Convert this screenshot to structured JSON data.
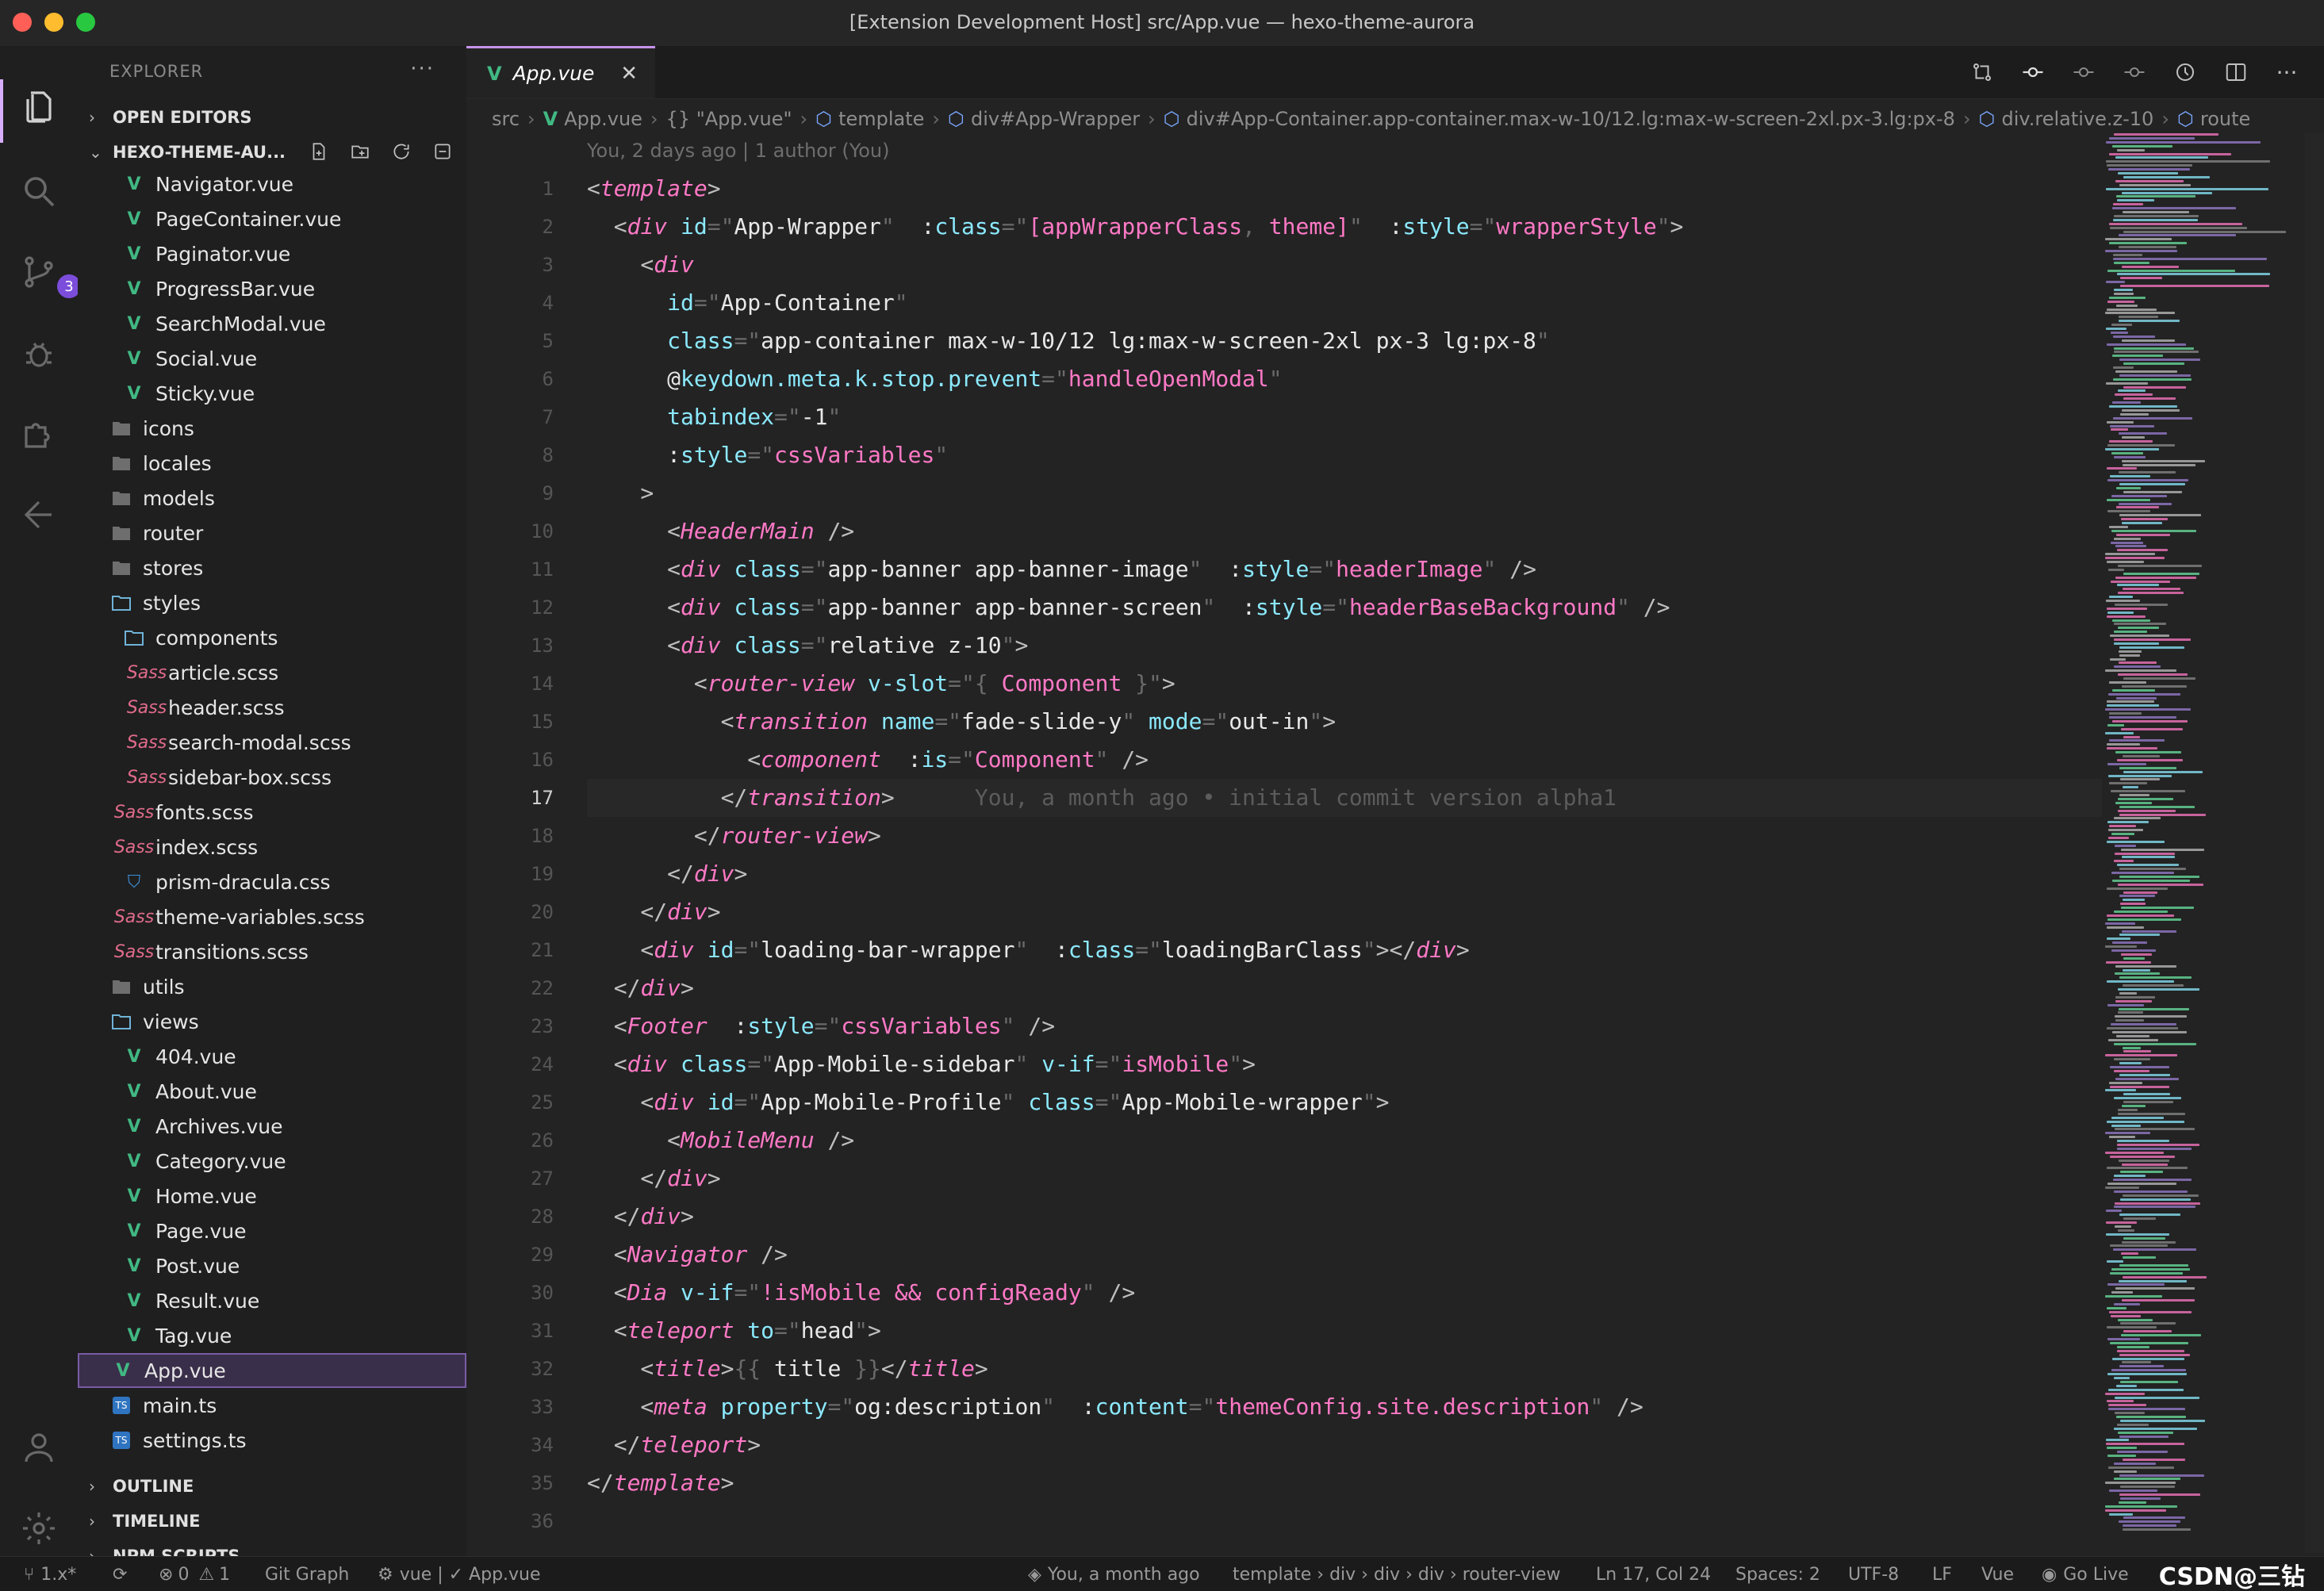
{
  "window": {
    "title": "[Extension Development Host] src/App.vue — hexo-theme-aurora"
  },
  "activity": {
    "scm_badge": "3"
  },
  "sidebar": {
    "header": "EXPLORER",
    "more": "···",
    "open_editors": "OPEN EDITORS",
    "project": "HEXO-THEME-AU...",
    "outline": "OUTLINE",
    "timeline": "TIMELINE",
    "npm": "NPM SCRIPTS",
    "tree": [
      {
        "label": "Navigator.vue",
        "type": "vue",
        "depth": 2
      },
      {
        "label": "PageContainer.vue",
        "type": "vue",
        "depth": 2
      },
      {
        "label": "Paginator.vue",
        "type": "vue",
        "depth": 2
      },
      {
        "label": "ProgressBar.vue",
        "type": "vue",
        "depth": 2
      },
      {
        "label": "SearchModal.vue",
        "type": "vue",
        "depth": 2
      },
      {
        "label": "Social.vue",
        "type": "vue",
        "depth": 2
      },
      {
        "label": "Sticky.vue",
        "type": "vue",
        "depth": 2
      },
      {
        "label": "icons",
        "type": "folder",
        "depth": 1
      },
      {
        "label": "locales",
        "type": "folder",
        "depth": 1
      },
      {
        "label": "models",
        "type": "folder",
        "depth": 1
      },
      {
        "label": "router",
        "type": "folder",
        "depth": 1
      },
      {
        "label": "stores",
        "type": "folder",
        "depth": 1
      },
      {
        "label": "styles",
        "type": "folder-open",
        "depth": 1
      },
      {
        "label": "components",
        "type": "folder-open",
        "depth": 2
      },
      {
        "label": "article.scss",
        "type": "sass",
        "depth": 3
      },
      {
        "label": "header.scss",
        "type": "sass",
        "depth": 3
      },
      {
        "label": "search-modal.scss",
        "type": "sass",
        "depth": 3
      },
      {
        "label": "sidebar-box.scss",
        "type": "sass",
        "depth": 3
      },
      {
        "label": "fonts.scss",
        "type": "sass",
        "depth": 2
      },
      {
        "label": "index.scss",
        "type": "sass",
        "depth": 2
      },
      {
        "label": "prism-dracula.css",
        "type": "css",
        "depth": 2
      },
      {
        "label": "theme-variables.scss",
        "type": "sass",
        "depth": 2
      },
      {
        "label": "transitions.scss",
        "type": "sass",
        "depth": 2
      },
      {
        "label": "utils",
        "type": "folder",
        "depth": 1
      },
      {
        "label": "views",
        "type": "folder-open",
        "depth": 1
      },
      {
        "label": "404.vue",
        "type": "vue",
        "depth": 2
      },
      {
        "label": "About.vue",
        "type": "vue",
        "depth": 2
      },
      {
        "label": "Archives.vue",
        "type": "vue",
        "depth": 2
      },
      {
        "label": "Category.vue",
        "type": "vue",
        "depth": 2
      },
      {
        "label": "Home.vue",
        "type": "vue",
        "depth": 2
      },
      {
        "label": "Page.vue",
        "type": "vue",
        "depth": 2
      },
      {
        "label": "Post.vue",
        "type": "vue",
        "depth": 2
      },
      {
        "label": "Result.vue",
        "type": "vue",
        "depth": 2
      },
      {
        "label": "Tag.vue",
        "type": "vue",
        "depth": 2
      },
      {
        "label": "App.vue",
        "type": "vue",
        "depth": 1,
        "selected": true
      },
      {
        "label": "main.ts",
        "type": "ts",
        "depth": 1
      },
      {
        "label": "settings.ts",
        "type": "ts",
        "depth": 1
      }
    ]
  },
  "editor": {
    "tab": {
      "label": "App.vue",
      "close": "✕"
    },
    "breadcrumb": [
      "src",
      "App.vue",
      "{} \"App.vue\"",
      "template",
      "div#App-Wrapper",
      "div#App-Container.app-container.max-w-10/12.lg:max-w-screen-2xl.px-3.lg:px-8",
      "div.relative.z-10",
      "route"
    ],
    "codelens": "You, 2 days ago | 1 author (You)",
    "current_line": 17,
    "blame": "You, a month ago • initial commit version alpha1",
    "lines": [
      [
        [
          "<",
          "pu"
        ],
        [
          "template",
          "tg"
        ],
        [
          ">",
          "pu"
        ]
      ],
      [
        [
          "  <",
          "pu"
        ],
        [
          "div",
          "tg"
        ],
        [
          " ",
          ""
        ],
        [
          "id",
          "at"
        ],
        [
          "=\"",
          "q"
        ],
        [
          "App-Wrapper",
          "wh"
        ],
        [
          "\"",
          "q"
        ],
        [
          "  :",
          ""
        ],
        [
          "class",
          "at"
        ],
        [
          "=\"",
          "q"
        ],
        [
          "[appWrapperClass",
          "st"
        ],
        [
          ", ",
          "q"
        ],
        [
          "theme]",
          "st"
        ],
        [
          "\"",
          "q"
        ],
        [
          "  :",
          ""
        ],
        [
          "style",
          "at"
        ],
        [
          "=\"",
          "q"
        ],
        [
          "wrapperStyle",
          "st"
        ],
        [
          "\"",
          "q"
        ],
        [
          ">",
          "pu"
        ]
      ],
      [
        [
          "    <",
          "pu"
        ],
        [
          "div",
          "tg"
        ]
      ],
      [
        [
          "      ",
          ""
        ],
        [
          "id",
          "at"
        ],
        [
          "=\"",
          "q"
        ],
        [
          "App-Container",
          "wh"
        ],
        [
          "\"",
          "q"
        ]
      ],
      [
        [
          "      ",
          ""
        ],
        [
          "class",
          "at"
        ],
        [
          "=\"",
          "q"
        ],
        [
          "app-container max-w-10/12 lg:max-w-screen-2xl px-3 lg:px-8",
          "wh"
        ],
        [
          "\"",
          "q"
        ]
      ],
      [
        [
          "      @",
          ""
        ],
        [
          "keydown.meta.k.stop.prevent",
          "at"
        ],
        [
          "=\"",
          "q"
        ],
        [
          "handleOpenModal",
          "st"
        ],
        [
          "\"",
          "q"
        ]
      ],
      [
        [
          "      ",
          ""
        ],
        [
          "tabindex",
          "at"
        ],
        [
          "=\"",
          "q"
        ],
        [
          "-1",
          "wh"
        ],
        [
          "\"",
          "q"
        ]
      ],
      [
        [
          "      :",
          ""
        ],
        [
          "style",
          "at"
        ],
        [
          "=\"",
          "q"
        ],
        [
          "cssVariables",
          "st"
        ],
        [
          "\"",
          "q"
        ]
      ],
      [
        [
          "    >",
          "pu"
        ]
      ],
      [
        [
          "      <",
          "pu"
        ],
        [
          "HeaderMain",
          "tg"
        ],
        [
          " />",
          "pu"
        ]
      ],
      [
        [
          "      <",
          "pu"
        ],
        [
          "div",
          "tg"
        ],
        [
          " ",
          ""
        ],
        [
          "class",
          "at"
        ],
        [
          "=\"",
          "q"
        ],
        [
          "app-banner app-banner-image",
          "wh"
        ],
        [
          "\"",
          "q"
        ],
        [
          "  :",
          ""
        ],
        [
          "style",
          "at"
        ],
        [
          "=\"",
          "q"
        ],
        [
          "headerImage",
          "st"
        ],
        [
          "\"",
          "q"
        ],
        [
          " />",
          "pu"
        ]
      ],
      [
        [
          "      <",
          "pu"
        ],
        [
          "div",
          "tg"
        ],
        [
          " ",
          ""
        ],
        [
          "class",
          "at"
        ],
        [
          "=\"",
          "q"
        ],
        [
          "app-banner app-banner-screen",
          "wh"
        ],
        [
          "\"",
          "q"
        ],
        [
          "  :",
          ""
        ],
        [
          "style",
          "at"
        ],
        [
          "=\"",
          "q"
        ],
        [
          "headerBaseBackground",
          "st"
        ],
        [
          "\"",
          "q"
        ],
        [
          " />",
          "pu"
        ]
      ],
      [
        [
          "      <",
          "pu"
        ],
        [
          "div",
          "tg"
        ],
        [
          " ",
          ""
        ],
        [
          "class",
          "at"
        ],
        [
          "=\"",
          "q"
        ],
        [
          "relative z-10",
          "wh"
        ],
        [
          "\"",
          "q"
        ],
        [
          ">",
          "pu"
        ]
      ],
      [
        [
          "        <",
          "pu"
        ],
        [
          "router-view",
          "tg"
        ],
        [
          " ",
          ""
        ],
        [
          "v-slot",
          "at"
        ],
        [
          "=\"",
          "q"
        ],
        [
          "{ ",
          "q"
        ],
        [
          "Component",
          "st"
        ],
        [
          " }",
          "q"
        ],
        [
          "\"",
          "q"
        ],
        [
          ">",
          "pu"
        ]
      ],
      [
        [
          "          <",
          "pu"
        ],
        [
          "transition",
          "tg"
        ],
        [
          " ",
          ""
        ],
        [
          "name",
          "at"
        ],
        [
          "=\"",
          "q"
        ],
        [
          "fade-slide-y",
          "wh"
        ],
        [
          "\"",
          "q"
        ],
        [
          " ",
          ""
        ],
        [
          "mode",
          "at"
        ],
        [
          "=\"",
          "q"
        ],
        [
          "out-in",
          "wh"
        ],
        [
          "\"",
          "q"
        ],
        [
          ">",
          "pu"
        ]
      ],
      [
        [
          "            <",
          "pu"
        ],
        [
          "component",
          "tg"
        ],
        [
          "  :",
          ""
        ],
        [
          "is",
          "at"
        ],
        [
          "=\"",
          "q"
        ],
        [
          "Component",
          "st"
        ],
        [
          "\"",
          "q"
        ],
        [
          " />",
          "pu"
        ]
      ],
      [
        [
          "          </",
          "pu"
        ],
        [
          "transition",
          "tg"
        ],
        [
          ">",
          "pu"
        ]
      ],
      [
        [
          "        </",
          "pu"
        ],
        [
          "router-view",
          "tg"
        ],
        [
          ">",
          "pu"
        ]
      ],
      [
        [
          "      </",
          "pu"
        ],
        [
          "div",
          "tg"
        ],
        [
          ">",
          "pu"
        ]
      ],
      [
        [
          "    </",
          "pu"
        ],
        [
          "div",
          "tg"
        ],
        [
          ">",
          "pu"
        ]
      ],
      [
        [
          "    <",
          "pu"
        ],
        [
          "div",
          "tg"
        ],
        [
          " ",
          ""
        ],
        [
          "id",
          "at"
        ],
        [
          "=\"",
          "q"
        ],
        [
          "loading-bar-wrapper",
          "wh"
        ],
        [
          "\"",
          "q"
        ],
        [
          "  :",
          ""
        ],
        [
          "class",
          "at"
        ],
        [
          "=\"",
          "q"
        ],
        [
          "loadingBarClass",
          "wh"
        ],
        [
          "\"",
          "q"
        ],
        [
          "></",
          "pu"
        ],
        [
          "div",
          "tg"
        ],
        [
          ">",
          "pu"
        ]
      ],
      [
        [
          "  </",
          "pu"
        ],
        [
          "div",
          "tg"
        ],
        [
          ">",
          "pu"
        ]
      ],
      [
        [
          "  <",
          "pu"
        ],
        [
          "Footer",
          "tg"
        ],
        [
          "  :",
          ""
        ],
        [
          "style",
          "at"
        ],
        [
          "=\"",
          "q"
        ],
        [
          "cssVariables",
          "st"
        ],
        [
          "\"",
          "q"
        ],
        [
          " />",
          "pu"
        ]
      ],
      [
        [
          "  <",
          "pu"
        ],
        [
          "div",
          "tg"
        ],
        [
          " ",
          ""
        ],
        [
          "class",
          "at"
        ],
        [
          "=\"",
          "q"
        ],
        [
          "App-Mobile-sidebar",
          "wh"
        ],
        [
          "\"",
          "q"
        ],
        [
          " ",
          ""
        ],
        [
          "v-if",
          "at"
        ],
        [
          "=\"",
          "q"
        ],
        [
          "isMobile",
          "st"
        ],
        [
          "\"",
          "q"
        ],
        [
          ">",
          "pu"
        ]
      ],
      [
        [
          "    <",
          "pu"
        ],
        [
          "div",
          "tg"
        ],
        [
          " ",
          ""
        ],
        [
          "id",
          "at"
        ],
        [
          "=\"",
          "q"
        ],
        [
          "App-Mobile-Profile",
          "wh"
        ],
        [
          "\"",
          "q"
        ],
        [
          " ",
          ""
        ],
        [
          "class",
          "at"
        ],
        [
          "=\"",
          "q"
        ],
        [
          "App-Mobile-wrapper",
          "wh"
        ],
        [
          "\"",
          "q"
        ],
        [
          ">",
          "pu"
        ]
      ],
      [
        [
          "      <",
          "pu"
        ],
        [
          "MobileMenu",
          "tg"
        ],
        [
          " />",
          "pu"
        ]
      ],
      [
        [
          "    </",
          "pu"
        ],
        [
          "div",
          "tg"
        ],
        [
          ">",
          "pu"
        ]
      ],
      [
        [
          "  </",
          "pu"
        ],
        [
          "div",
          "tg"
        ],
        [
          ">",
          "pu"
        ]
      ],
      [
        [
          "  <",
          "pu"
        ],
        [
          "Navigator",
          "tg"
        ],
        [
          " />",
          "pu"
        ]
      ],
      [
        [
          "  <",
          "pu"
        ],
        [
          "Dia",
          "tg"
        ],
        [
          " ",
          ""
        ],
        [
          "v-if",
          "at"
        ],
        [
          "=\"",
          "q"
        ],
        [
          "!isMobile && configReady",
          "st"
        ],
        [
          "\"",
          "q"
        ],
        [
          " />",
          "pu"
        ]
      ],
      [
        [
          "  <",
          "pu"
        ],
        [
          "teleport",
          "tg"
        ],
        [
          " ",
          ""
        ],
        [
          "to",
          "at"
        ],
        [
          "=\"",
          "q"
        ],
        [
          "head",
          "wh"
        ],
        [
          "\"",
          "q"
        ],
        [
          ">",
          "pu"
        ]
      ],
      [
        [
          "    <",
          "pu"
        ],
        [
          "title",
          "tg"
        ],
        [
          ">",
          "pu"
        ],
        [
          "{{ ",
          "q"
        ],
        [
          "title",
          "wh"
        ],
        [
          " }}",
          "q"
        ],
        [
          "</",
          "pu"
        ],
        [
          "title",
          "tg"
        ],
        [
          ">",
          "pu"
        ]
      ],
      [
        [
          "    <",
          "pu"
        ],
        [
          "meta",
          "tg"
        ],
        [
          " ",
          ""
        ],
        [
          "property",
          "at"
        ],
        [
          "=\"",
          "q"
        ],
        [
          "og:description",
          "wh"
        ],
        [
          "\"",
          "q"
        ],
        [
          "  :",
          ""
        ],
        [
          "content",
          "at"
        ],
        [
          "=\"",
          "q"
        ],
        [
          "themeConfig.site.description",
          "st"
        ],
        [
          "\"",
          "q"
        ],
        [
          " />",
          "pu"
        ]
      ],
      [
        [
          "  </",
          "pu"
        ],
        [
          "teleport",
          "tg"
        ],
        [
          ">",
          "pu"
        ]
      ],
      [
        [
          "</",
          "pu"
        ],
        [
          "template",
          "tg"
        ],
        [
          ">",
          "pu"
        ]
      ],
      [
        [
          "",
          ""
        ]
      ]
    ]
  },
  "statusbar": {
    "branch": "1.x*",
    "errors": "0",
    "warnings": "1",
    "git_graph": "Git Graph",
    "vue_version": "vue | ✓ App.vue",
    "blame": "You, a month ago",
    "breadcrumb": "template › div › div › div › router-view",
    "position": "Ln 17, Col 24",
    "spaces": "Spaces: 2",
    "encoding": "UTF-8",
    "eol": "LF",
    "language": "Vue",
    "go_live": "Go Live",
    "watermark": "CSDN@三钻"
  }
}
